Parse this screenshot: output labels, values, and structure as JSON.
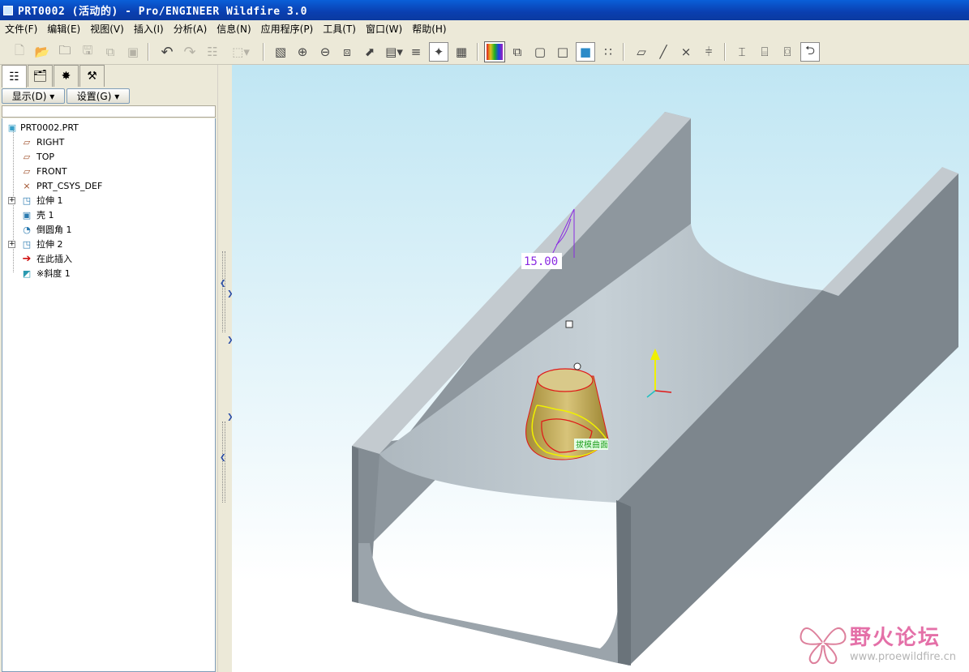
{
  "window": {
    "title": "PRT0002 (活动的) - Pro/ENGINEER Wildfire 3.0"
  },
  "menu": [
    "文件(F)",
    "编辑(E)",
    "视图(V)",
    "插入(I)",
    "分析(A)",
    "信息(N)",
    "应用程序(P)",
    "工具(T)",
    "窗口(W)",
    "帮助(H)"
  ],
  "toolbar": {
    "icons": [
      "new-icon",
      "open-icon",
      "open-folder-icon",
      "save-icon",
      "save-copy-icon",
      "backup-icon",
      "undo-icon",
      "redo-icon",
      "regenerate-icon",
      "select-box-icon",
      "repaint-icon",
      "zoom-in-icon",
      "zoom-out-icon",
      "refit-icon",
      "orient-icon",
      "saved-views-icon",
      "layers-icon",
      "spin-center-icon",
      "view-manager-icon",
      "color-appearance-icon",
      "wireframe-icon",
      "hidden-line-icon",
      "no-hidden-icon",
      "shading-icon",
      "model-tree-icon",
      "datum-planes-icon",
      "datum-axes-icon",
      "datum-points-icon",
      "csys-icon",
      "measure-icon",
      "measure-area-icon",
      "measure-angle-icon",
      "context-help-icon"
    ]
  },
  "left_panel": {
    "display_button": "显示(D)",
    "settings_button": "设置(G)",
    "tree": [
      {
        "label": "PRT0002.PRT",
        "icon": "part-icon",
        "expandable": false
      },
      {
        "label": "RIGHT",
        "icon": "datum-plane-icon",
        "expandable": false
      },
      {
        "label": "TOP",
        "icon": "datum-plane-icon",
        "expandable": false
      },
      {
        "label": "FRONT",
        "icon": "datum-plane-icon",
        "expandable": false
      },
      {
        "label": "PRT_CSYS_DEF",
        "icon": "csys-icon",
        "expandable": false
      },
      {
        "label": "拉伸 1",
        "icon": "extrude-icon",
        "expandable": true
      },
      {
        "label": "壳 1",
        "icon": "shell-icon",
        "expandable": false
      },
      {
        "label": "倒圆角 1",
        "icon": "round-icon",
        "expandable": false
      },
      {
        "label": "拉伸 2",
        "icon": "extrude-icon",
        "expandable": true
      },
      {
        "label": "在此插入",
        "icon": "insert-here-arrow-icon",
        "expandable": false
      },
      {
        "label": "※斜度 1",
        "icon": "draft-icon",
        "expandable": false
      }
    ]
  },
  "viewport": {
    "dimension_text": "15.00",
    "surface_tag": "拔模曲面",
    "watermark_text": "野火论坛",
    "watermark_url": "www.proewildfire.cn",
    "colors": {
      "model": "#8d959c",
      "bg_top": "#c0e6f3",
      "bg_bottom": "#ffffff",
      "boss": "#b8a24e",
      "edge_red": "#e01818",
      "edge_yellow": "#f0f000",
      "dim": "#8a2be2"
    }
  }
}
